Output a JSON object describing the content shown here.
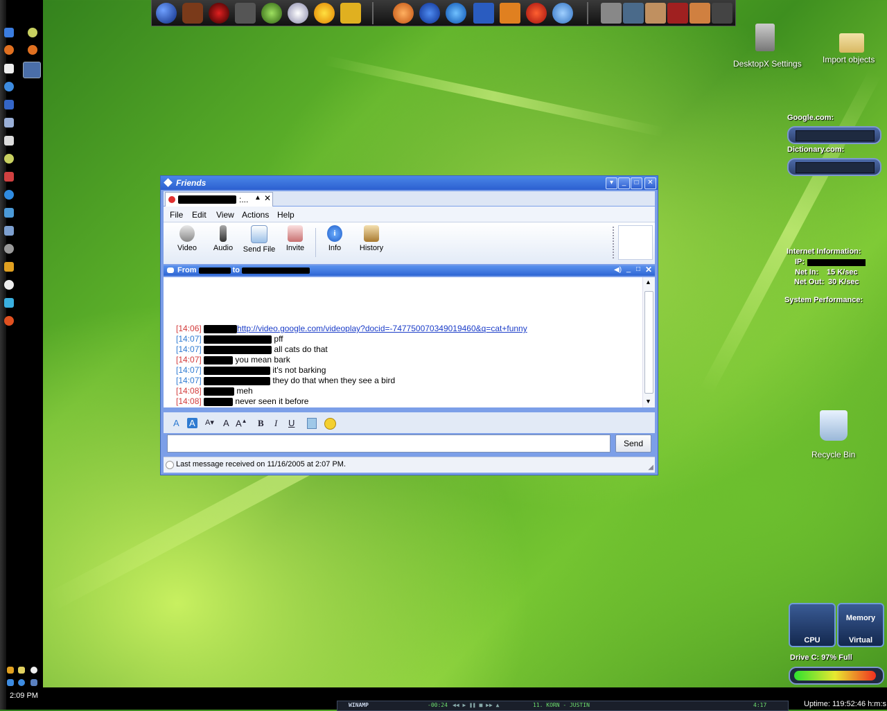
{
  "desktop": {
    "icons": {
      "desktopx_settings": "DesktopX Settings",
      "import_objects": "Import objects",
      "recycle_bin": "Recycle Bin"
    },
    "widgets": {
      "google_label": "Google.com:",
      "dictionary_label": "Dictionary.com:",
      "internet_info_label": "Internet Information:",
      "ip_label": "IP:",
      "net_in_label": "Net In:",
      "net_in_value": "15 K/sec",
      "net_out_label": "Net Out:",
      "net_out_value": "30 K/sec",
      "system_performance_label": "System Performance:",
      "cpu_label": "CPU",
      "memory_label": "Memory",
      "virtual_label": "Virtual",
      "drive_label": "Drive C: 97% Full",
      "drive_fill": 0.97
    },
    "clock": "2:09 PM",
    "uptime": "Uptime: 119:52:46 h:m:s",
    "winamp": {
      "label": "WINAMP",
      "time": "-00:24",
      "track": "11. KORN - JUSTIN",
      "duration": "4:17"
    }
  },
  "window": {
    "title": "Friends",
    "tab_label": ":...",
    "menu": [
      "File",
      "Edit",
      "View",
      "Actions",
      "Help"
    ],
    "toolbar": {
      "video": "Video",
      "audio": "Audio",
      "send_file": "Send File",
      "invite": "Invite",
      "info": "Info",
      "history": "History"
    },
    "conversation": {
      "header_from": "From",
      "header_to": "to",
      "messages": [
        {
          "time": "[14:06]",
          "text": "http://video.google.com/videoplay?docid=-747750070349019460&q=cat+funny"
        },
        {
          "time": "[14:07]",
          "text": "pff"
        },
        {
          "time": "[14:07]",
          "text": "all cats do that"
        },
        {
          "time": "[14:07]",
          "text": "you mean bark"
        },
        {
          "time": "[14:07]",
          "text": "it's not barking"
        },
        {
          "time": "[14:07]",
          "text": "they do that when they see a bird"
        },
        {
          "time": "[14:08]",
          "text": "meh"
        },
        {
          "time": "[14:08]",
          "text": "never seen it before"
        }
      ]
    },
    "input_value": "",
    "send_label": "Send",
    "status": "Last message received on 11/16/2005 at 2:07 PM."
  }
}
